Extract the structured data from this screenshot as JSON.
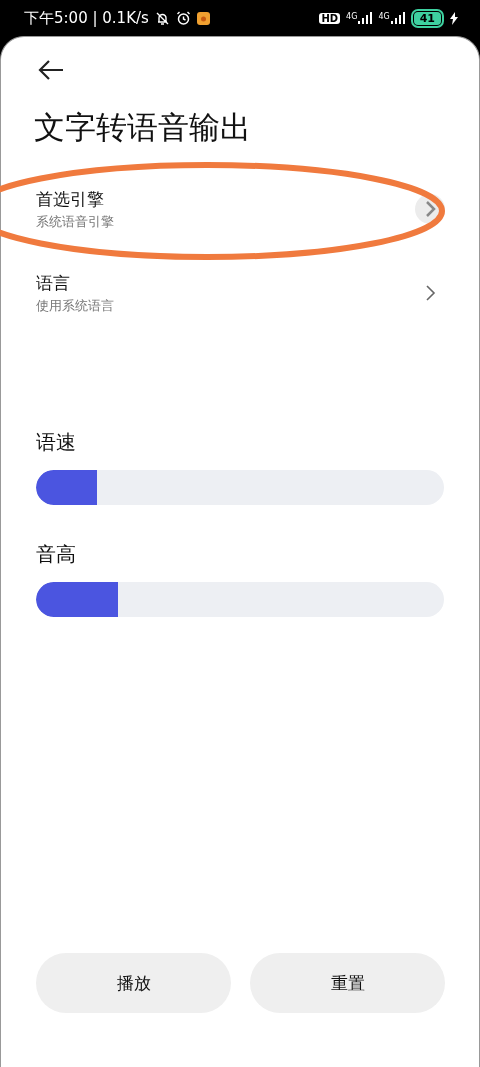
{
  "status_bar": {
    "time": "下午5:00 | 0.1K/s",
    "hd": "HD",
    "networks": [
      "4G",
      "4G"
    ],
    "battery": "41"
  },
  "title": "文字转语音输出",
  "settings": [
    {
      "label": "首选引擎",
      "value": "系统语音引擎",
      "pressed": true,
      "circled": true
    },
    {
      "label": "语言",
      "value": "使用系统语言",
      "pressed": false,
      "circled": false
    }
  ],
  "sliders": [
    {
      "label": "语速",
      "level": 0.15
    },
    {
      "label": "音高",
      "level": 0.2
    }
  ],
  "buttons": [
    "播放",
    "重置"
  ]
}
